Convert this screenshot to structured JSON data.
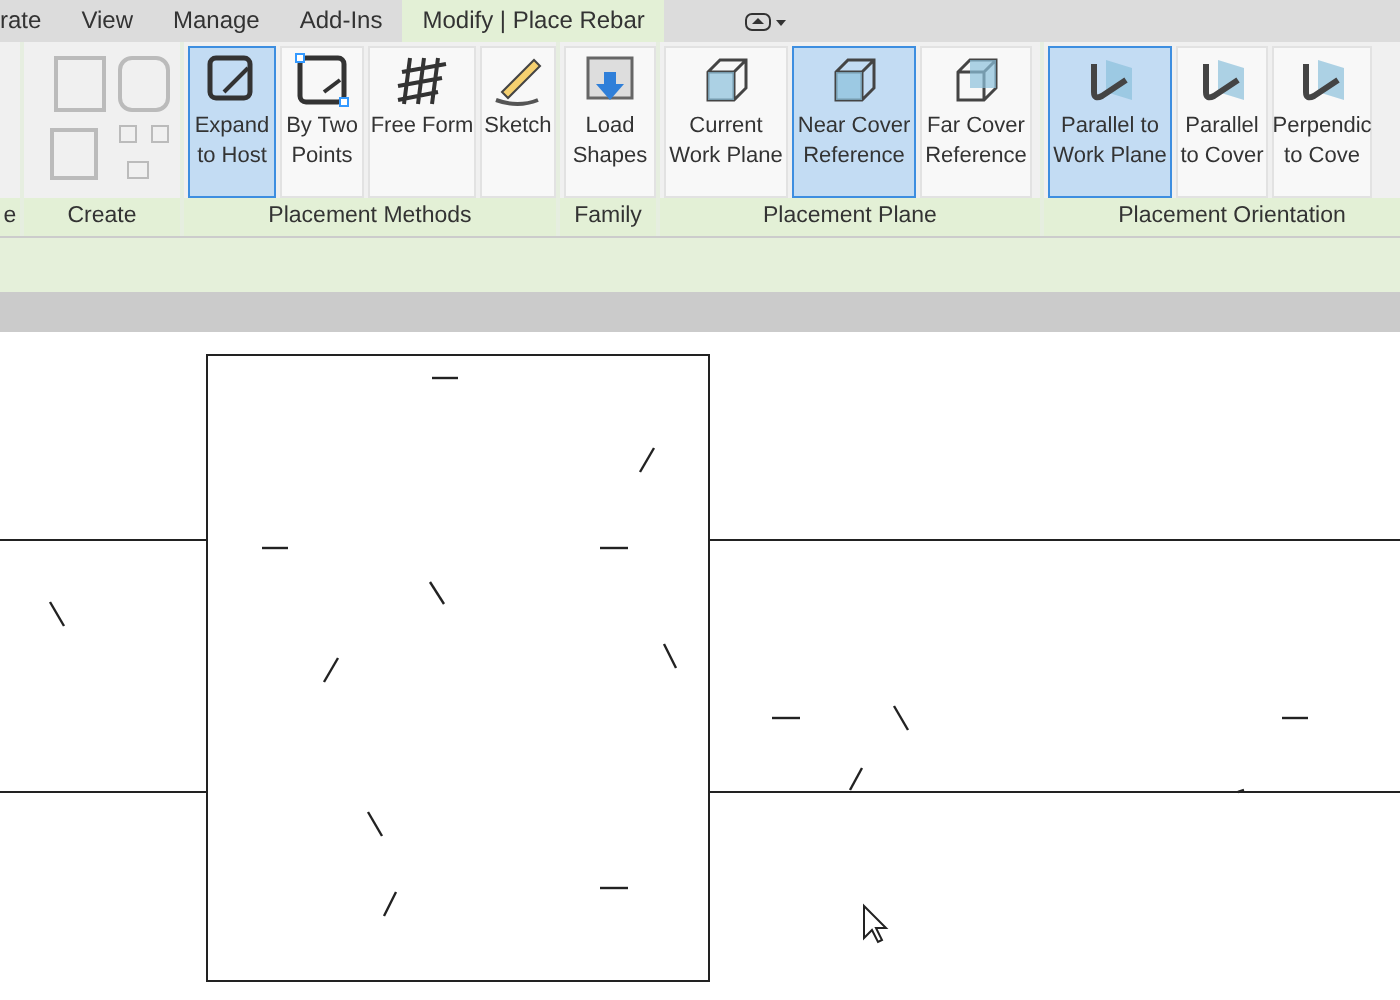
{
  "tabs": [
    {
      "label": "rate",
      "selected": false
    },
    {
      "label": "View",
      "selected": false
    },
    {
      "label": "Manage",
      "selected": false
    },
    {
      "label": "Add-Ins",
      "selected": false
    },
    {
      "label": "Modify | Place Rebar",
      "selected": true
    }
  ],
  "ribbon": {
    "panels": [
      {
        "label": "e"
      },
      {
        "label": "Create"
      },
      {
        "label": "Placement Methods",
        "buttons": [
          {
            "label": "Expand to Host",
            "selected": true
          },
          {
            "label": "By Two Points",
            "selected": false
          },
          {
            "label": "Free Form",
            "selected": false
          },
          {
            "label": "Sketch",
            "selected": false
          }
        ]
      },
      {
        "label": "Family",
        "buttons": [
          {
            "label": "Load Shapes",
            "selected": false
          }
        ]
      },
      {
        "label": "Placement Plane",
        "buttons": [
          {
            "label": "Current Work Plane",
            "selected": false
          },
          {
            "label": "Near Cover Reference",
            "selected": true
          },
          {
            "label": "Far Cover Reference",
            "selected": false
          }
        ]
      },
      {
        "label": "Placement Orientation",
        "buttons": [
          {
            "label": "Parallel to Work Plane",
            "selected": true
          },
          {
            "label": "Parallel to Cover",
            "selected": false
          },
          {
            "label": "Perpendic to Cove",
            "selected": false
          }
        ]
      }
    ]
  }
}
